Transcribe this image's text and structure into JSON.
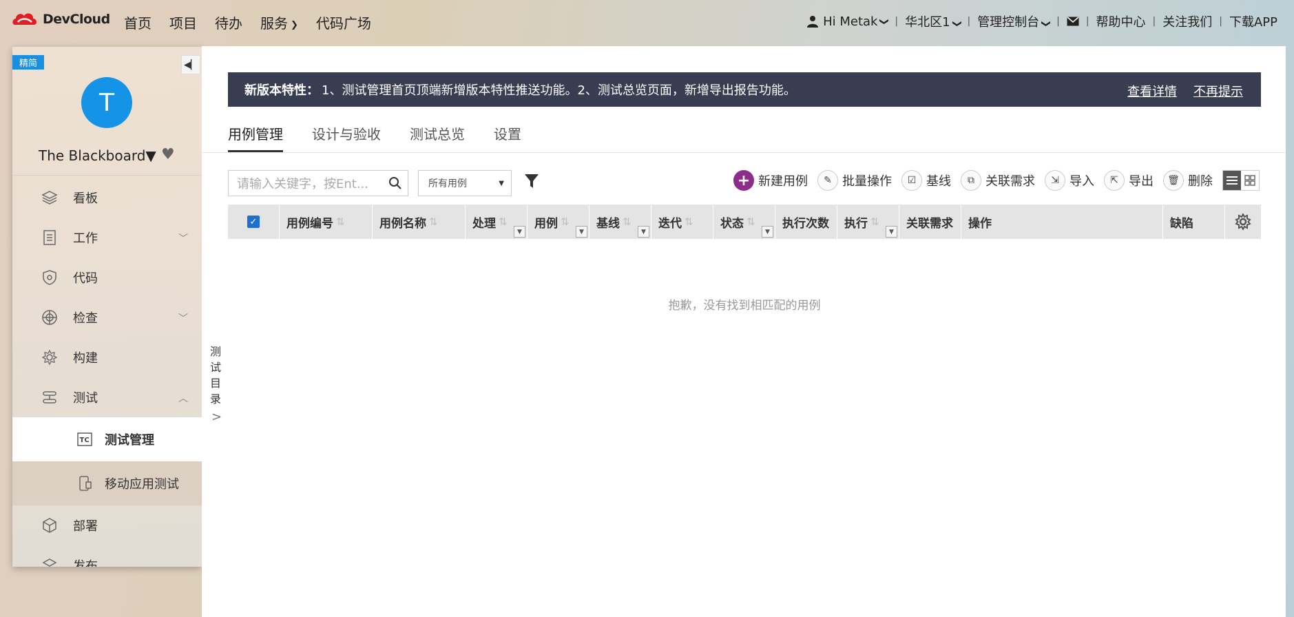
{
  "brand": {
    "name": "DevCloud",
    "accent": "#e51c23"
  },
  "nav_main": [
    "首页",
    "项目",
    "待办",
    "服务",
    "代码广场"
  ],
  "nav_right": {
    "user": "Hi Metak",
    "region": "华北区1",
    "console": "管理控制台",
    "help": "帮助中心",
    "follow": "关注我们",
    "download": "下载APP"
  },
  "sidebar": {
    "mode_badge": "精简",
    "avatar_letter": "T",
    "project_name": "The Blackboard▼",
    "items": [
      {
        "label": "看板",
        "icon": "layers-icon"
      },
      {
        "label": "工作",
        "icon": "document-list-icon"
      },
      {
        "label": "代码",
        "icon": "code-shield-icon"
      },
      {
        "label": "检查",
        "icon": "target-icon"
      },
      {
        "label": "构建",
        "icon": "gear-build-icon"
      },
      {
        "label": "测试",
        "icon": "test-flow-icon"
      }
    ],
    "sub_items": [
      {
        "label": "测试管理",
        "icon": "tc-icon"
      },
      {
        "label": "移动应用测试",
        "icon": "mobile-test-icon"
      }
    ],
    "items_after": [
      {
        "label": "部署",
        "icon": "cube-icon"
      },
      {
        "label": "发布",
        "icon": "release-icon"
      }
    ]
  },
  "notice": {
    "title": "新版本特性：",
    "text": "1、测试管理首页顶端新增版本特性推送功能。2、测试总览页面，新增导出报告功能。",
    "link_details": "查看详情",
    "link_dismiss": "不再提示"
  },
  "tabs": [
    "用例管理",
    "设计与验收",
    "测试总览",
    "设置"
  ],
  "filters": {
    "search_placeholder": "请输入关键字，按Ent...",
    "case_filter": "所有用例"
  },
  "toolbar": {
    "new_case": "新建用例",
    "batch": "批量操作",
    "baseline": "基线",
    "link_req": "关联需求",
    "import": "导入",
    "export": "导出",
    "delete": "删除"
  },
  "table": {
    "headers": [
      "用例编号",
      "用例名称",
      "处理",
      "用例",
      "基线",
      "迭代",
      "状态",
      "执行次数",
      "执行",
      "关联需求",
      "操作",
      "缺陷"
    ],
    "empty_text": "抱歉，没有找到相匹配的用例"
  },
  "test_directory": [
    "测",
    "试",
    "目",
    "录"
  ]
}
